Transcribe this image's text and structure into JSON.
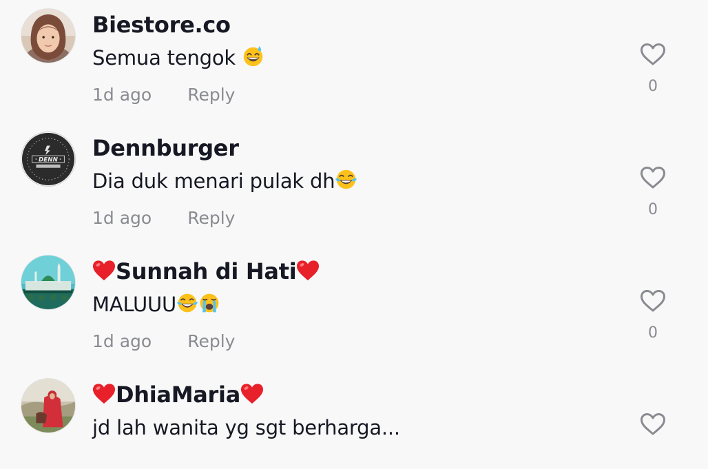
{
  "comments": [
    {
      "username": "Biestore.co",
      "text": "Semua tengok",
      "emojis": [
        "grinning-sweat-emoji"
      ],
      "time": "1d ago",
      "reply": "Reply",
      "likes": "0",
      "avatar": "woman-hijab-photo"
    },
    {
      "username": "Dennburger",
      "text": "Dia duk menari pulak dh",
      "emojis": [
        "tears-of-joy-emoji"
      ],
      "time": "1d ago",
      "reply": "Reply",
      "likes": "0",
      "avatar": "denn-burger-logo"
    },
    {
      "username": "Sunnah di Hati",
      "username_prefix_emoji": "red-heart-emoji",
      "username_suffix_emoji": "red-heart-emoji",
      "text": "MALUUU",
      "emojis": [
        "tears-of-joy-emoji",
        "loudly-crying-emoji"
      ],
      "time": "1d ago",
      "reply": "Reply",
      "likes": "0",
      "avatar": "mosque-photo"
    },
    {
      "username": "DhiaMaria",
      "username_prefix_emoji": "red-heart-emoji",
      "username_suffix_emoji": "red-heart-emoji",
      "text": "jd lah wanita yg sgt berharga...",
      "emojis": [],
      "time": "",
      "reply": "",
      "likes": "",
      "avatar": "woman-red-dress-photo"
    }
  ],
  "colors": {
    "background": "#f8f8f8",
    "username": "#161823",
    "meta": "#8a8b91",
    "heart_outline": "#8a8b91",
    "emoji_heart": "#e8202a",
    "emoji_face": "#fcc21b"
  }
}
